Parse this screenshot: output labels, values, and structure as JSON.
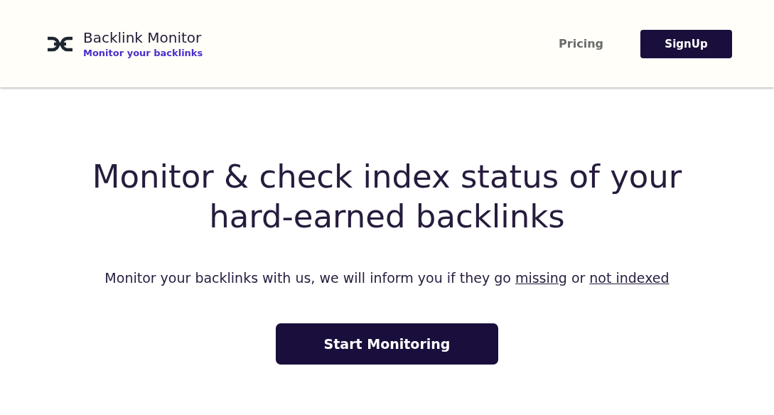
{
  "header": {
    "brand": {
      "title": "Backlink Monitor",
      "tagline": "Monitor your backlinks"
    },
    "nav": [
      {
        "kind": "link",
        "label": "Pricing"
      },
      {
        "kind": "button",
        "label": "SignUp"
      }
    ]
  },
  "hero": {
    "heading": "Monitor & check index status of your hard-earned backlinks",
    "subtitle": [
      {
        "kind": "text",
        "text": "Monitor your backlinks with us, we will inform you if they go"
      },
      {
        "kind": "link",
        "text": "missing"
      },
      {
        "kind": "text",
        "text": "or"
      },
      {
        "kind": "link",
        "text": "not indexed"
      }
    ],
    "cta": "Start Monitoring"
  }
}
